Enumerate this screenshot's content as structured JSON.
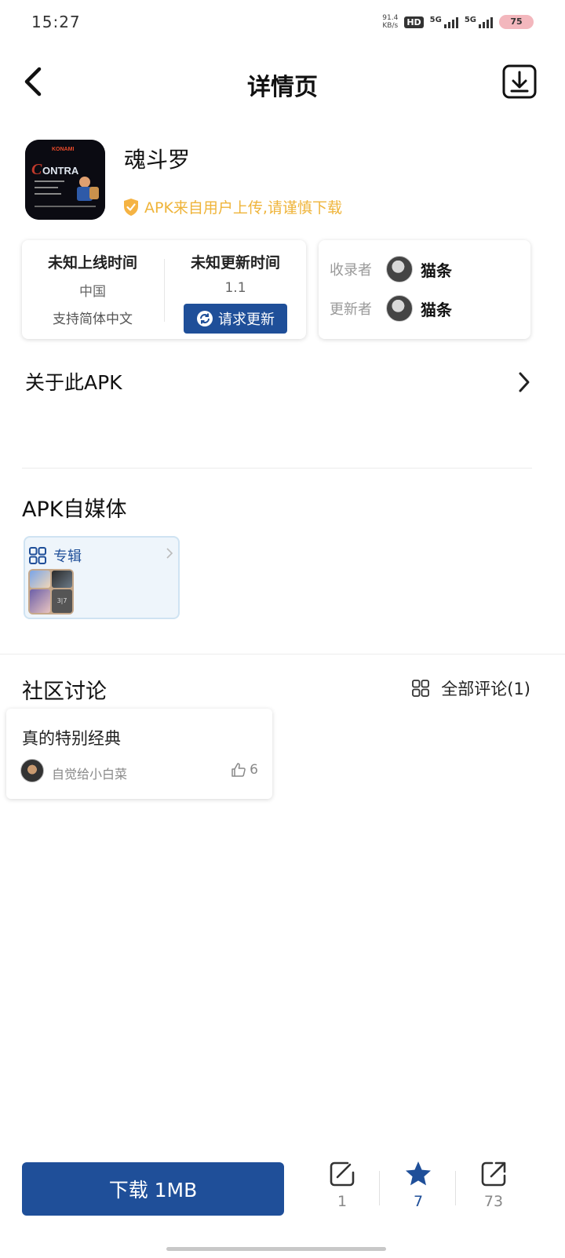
{
  "status_bar": {
    "time": "15:27",
    "net_speed_value": "91.4",
    "net_speed_unit": "KB/s",
    "hd_label": "HD",
    "sim_numbers": "1 2",
    "signal1_label": "5G",
    "signal2_label": "5G",
    "battery": "75"
  },
  "header": {
    "title": "详情页"
  },
  "app": {
    "name": "魂斗罗",
    "icon_text": "CONTRA",
    "warning": "APK来自用户上传,请谨慎下载"
  },
  "info": {
    "online_time": "未知上线时间",
    "region": "中国",
    "language": "支持简体中文",
    "update_time": "未知更新时间",
    "version": "1.1",
    "request_update_label": "请求更新",
    "collector_label": "收录者",
    "collector_name": "猫条",
    "updater_label": "更新者",
    "updater_name": "猫条"
  },
  "about": {
    "title": "关于此APK"
  },
  "media": {
    "title": "APK自媒体",
    "album_label": "专辑",
    "thumb_badge": "3|7"
  },
  "community": {
    "title": "社区讨论",
    "all_comments_label": "全部评论(1)",
    "comments": [
      {
        "text": "真的特别经典",
        "user": "自觉给小白菜",
        "likes": "6"
      }
    ]
  },
  "bottom_bar": {
    "download_label": "下载 1MB",
    "edit_count": "1",
    "favorite_count": "7",
    "share_count": "73"
  },
  "colors": {
    "primary": "#1f4f99",
    "warning": "#efb43a"
  }
}
